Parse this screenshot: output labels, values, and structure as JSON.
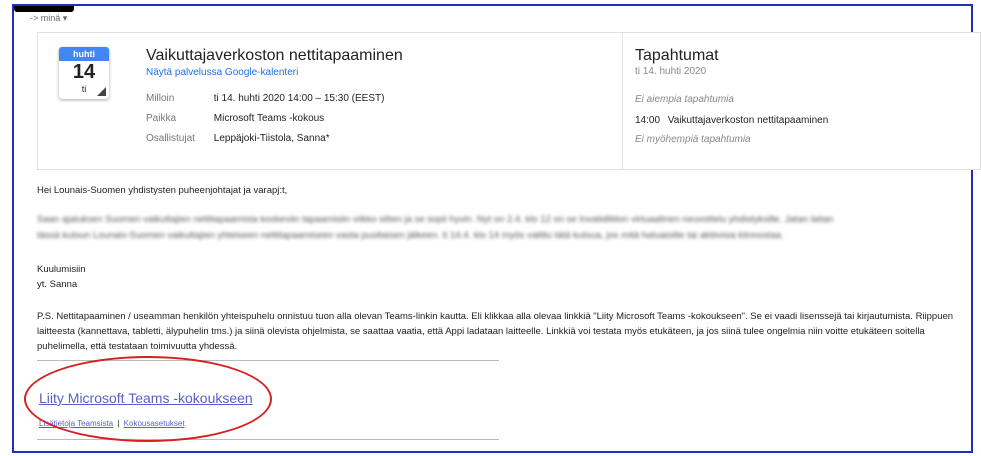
{
  "header": {
    "to_me": "-> minä ▾"
  },
  "calendar_badge": {
    "month": "huhti",
    "day": "14",
    "weekday": "ti"
  },
  "event": {
    "title": "Vaikuttajaverkoston nettitapaaminen",
    "gcal_link": "Näytä palvelussa Google-kalenteri",
    "when_label": "Milloin",
    "when_value": "ti 14. huhti 2020 14:00 – 15:30 (EEST)",
    "where_label": "Paikka",
    "where_value": "Microsoft Teams -kokous",
    "attendees_label": "Osallistujat",
    "attendees_value": "Leppäjoki-Tiistola, Sanna*"
  },
  "schedule": {
    "title": "Tapahtumat",
    "date": "ti 14. huhti 2020",
    "no_earlier": "Ei aiempia tapahtumia",
    "event_time": "14:00",
    "event_name": "Vaikuttajaverkoston nettitapaaminen",
    "no_later": "Ei myöhempiä tapahtumia"
  },
  "message": {
    "greeting": "Hei Lounais-Suomen yhdistysten puheenjohtajat ja varapj:t,",
    "para1_line1": "Saan ajatuksen Suomen vaikuttajien nettitapaamista koskeviin tapaamisiin viikko sitten ja se sopii hyvin. Nyt on 2.4. klo 12 on se Invalidiliiton virtuaalinen neuvottelu yhdistyksille. Jatan laitan",
    "para1_line2": "tässä kutsun Lounais-Suomen vaikuttajien yhteiseen nettitapaamiseen vasta puoltaisen jälkeen. ti 14.4. klo 14 myös valittu tätä kutsua, jos mitä haluaisitte tai aktiivisia kiinnostaa.",
    "regards": "Kuulumisiin",
    "signature": "yt. Sanna",
    "ps": "P.S. Nettitapaaminen / useamman henkilön yhteispuhelu onnistuu tuon alla olevan Teams-linkin kautta. Eli klikkaa alla olevaa linkkiä \"Liity Microsoft Teams -kokoukseen\". Se ei vaadi lisenssejä tai kirjautumista. Riippuen laitteesta (kannettava, tabletti, älypuhelin tms.) ja siinä olevista ohjelmista, se saattaa vaatia, että Appi ladataan laitteelle. Linkkiä voi testata myös etukäteen, ja jos siinä tulee ongelmia niin voitte etukäteen soitella puhelimella, että testataan toimivuutta yhdessä."
  },
  "teams": {
    "join_link": "Liity Microsoft Teams -kokoukseen",
    "more_info": "Lisätietoja Teamsista",
    "separator": "|",
    "settings": "Kokousasetukset"
  },
  "colors": {
    "frame_border": "#1f2fbf",
    "calendar_blue": "#4285f4",
    "link_blue": "#1a73e8",
    "teams_purple": "#5b5fc7",
    "annotation_red": "#d62020"
  }
}
